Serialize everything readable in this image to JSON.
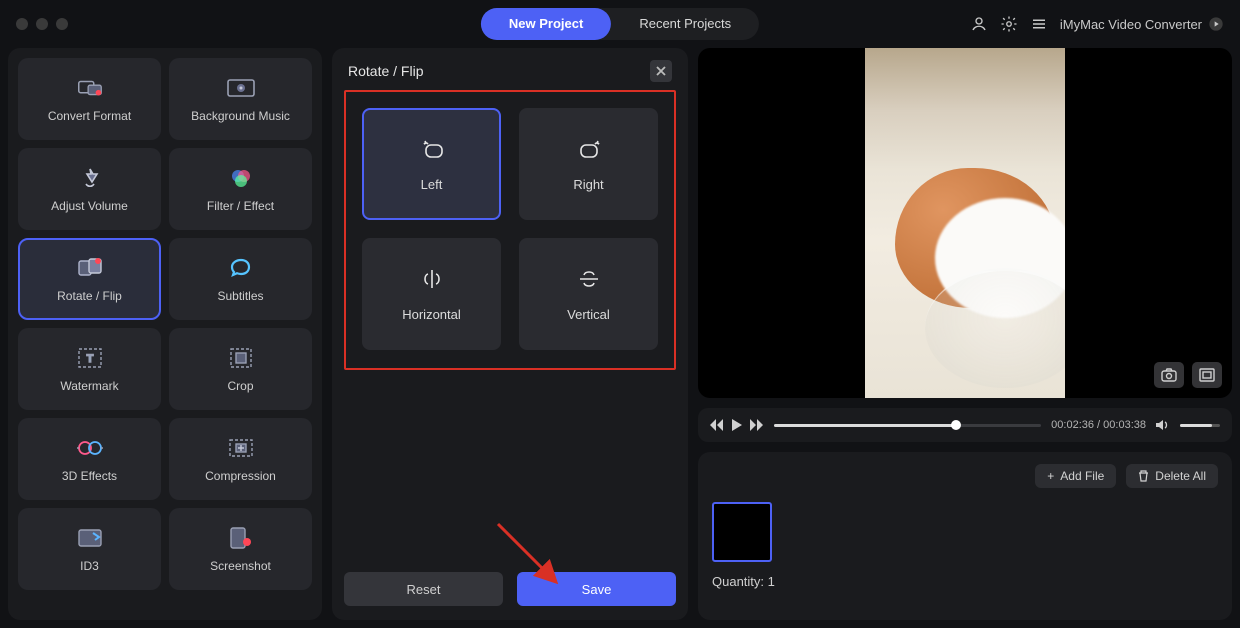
{
  "header": {
    "tab_new": "New Project",
    "tab_recent": "Recent Projects",
    "app_name": "iMyMac Video Converter"
  },
  "sidebar": {
    "tools": [
      {
        "name": "convert-format",
        "label": "Convert Format"
      },
      {
        "name": "background-music",
        "label": "Background Music"
      },
      {
        "name": "adjust-volume",
        "label": "Adjust Volume"
      },
      {
        "name": "filter-effect",
        "label": "Filter / Effect"
      },
      {
        "name": "rotate-flip",
        "label": "Rotate / Flip",
        "selected": true
      },
      {
        "name": "subtitles",
        "label": "Subtitles"
      },
      {
        "name": "watermark",
        "label": "Watermark"
      },
      {
        "name": "crop",
        "label": "Crop"
      },
      {
        "name": "3d-effects",
        "label": "3D Effects"
      },
      {
        "name": "compression",
        "label": "Compression"
      },
      {
        "name": "id3",
        "label": "ID3"
      },
      {
        "name": "screenshot",
        "label": "Screenshot"
      }
    ]
  },
  "panel": {
    "title": "Rotate / Flip",
    "options": {
      "left": "Left",
      "right": "Right",
      "horizontal": "Horizontal",
      "vertical": "Vertical"
    },
    "reset": "Reset",
    "save": "Save"
  },
  "player": {
    "time_current": "00:02:36",
    "time_total": "00:03:38"
  },
  "queue": {
    "add_file": "Add File",
    "delete_all": "Delete All",
    "quantity_label": "Quantity:",
    "quantity_value": "1"
  }
}
